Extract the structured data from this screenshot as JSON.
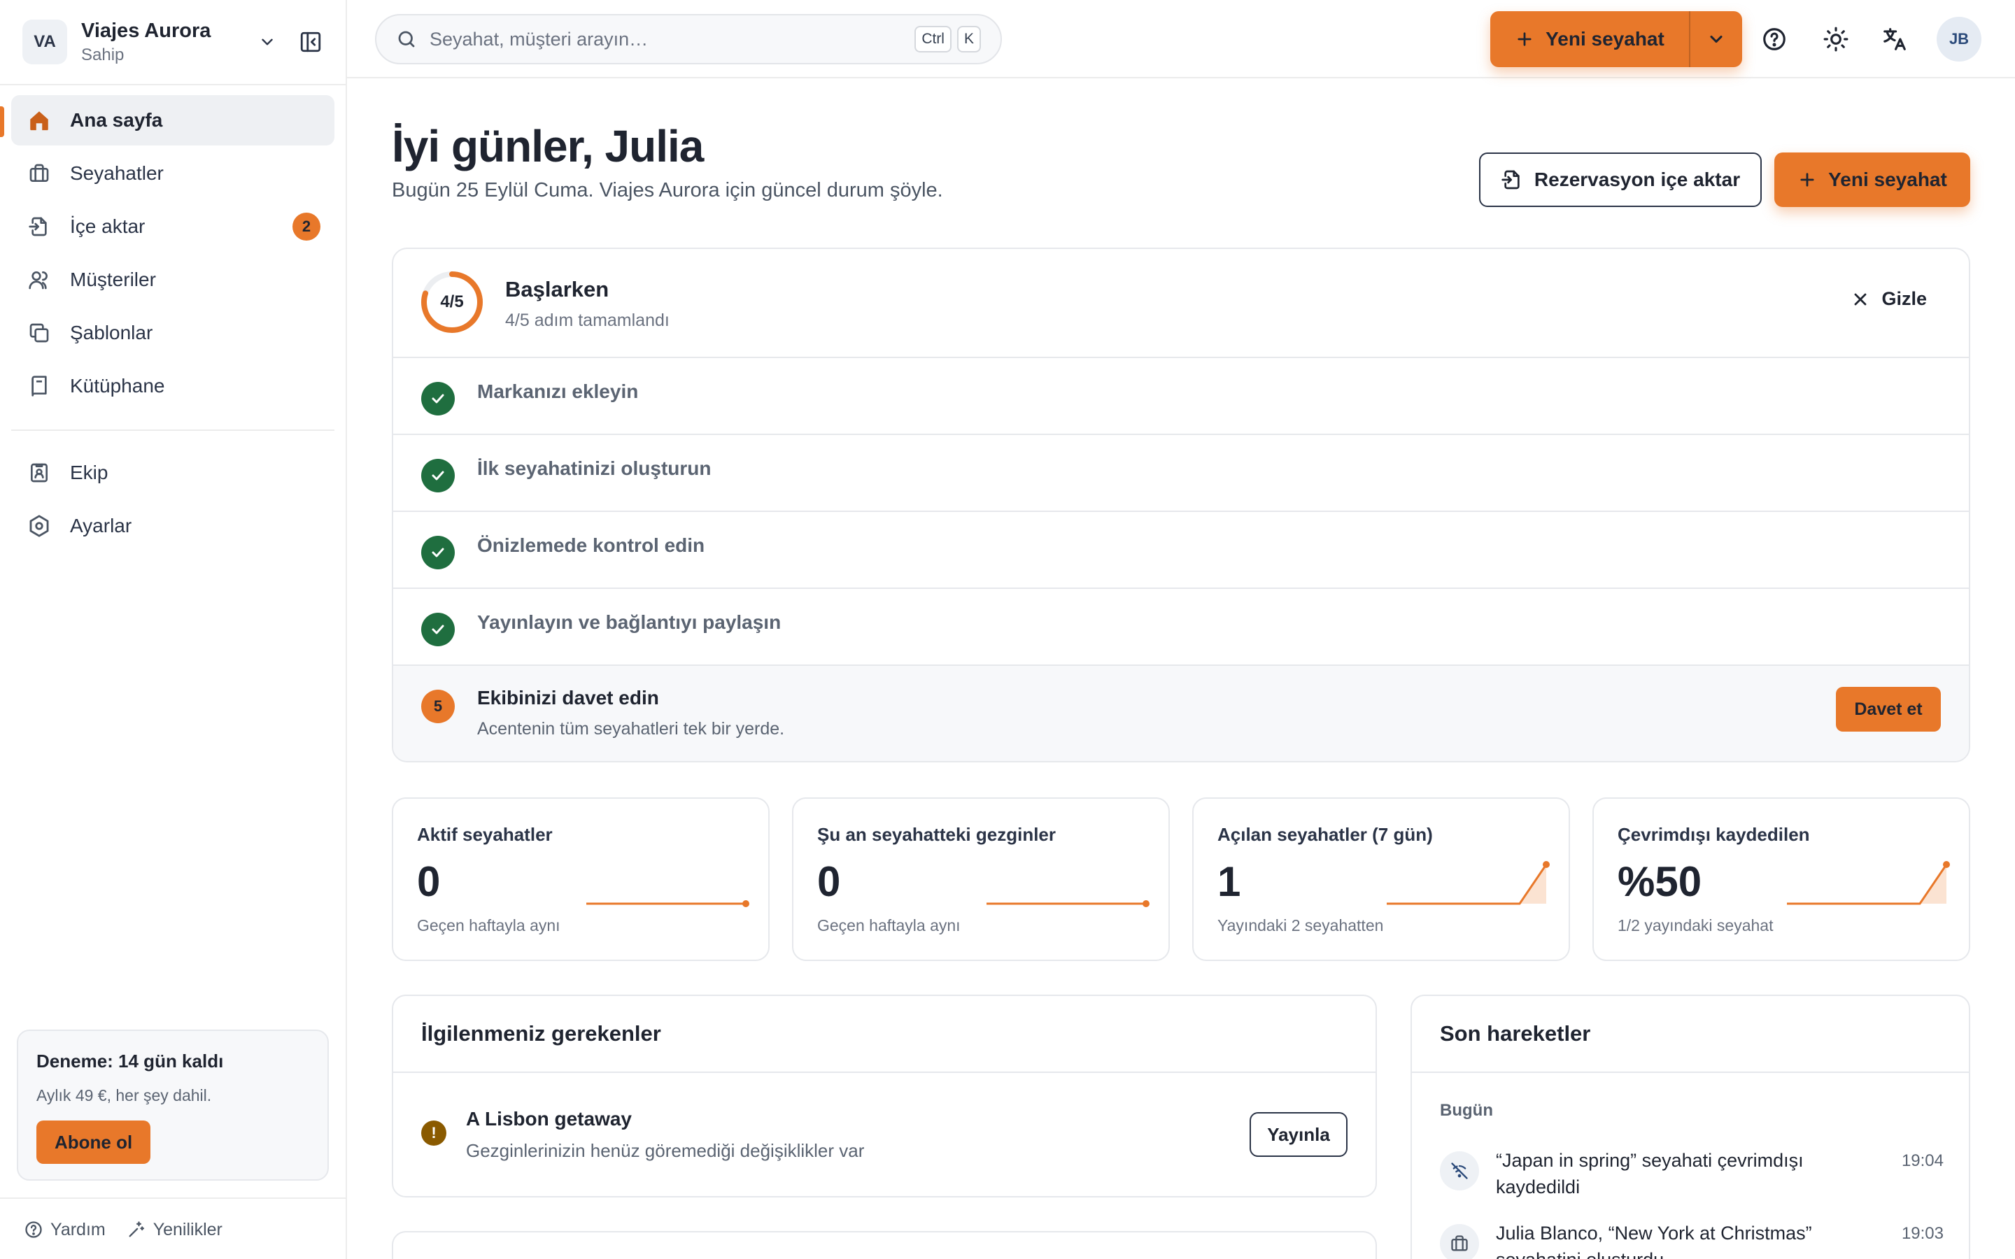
{
  "workspace": {
    "initials": "VA",
    "name": "Viajes Aurora",
    "role": "Sahip"
  },
  "nav": {
    "primary": [
      {
        "label": "Ana sayfa",
        "icon": "home-icon",
        "active": true
      },
      {
        "label": "Seyahatler",
        "icon": "briefcase-icon"
      },
      {
        "label": "İçe aktar",
        "icon": "file-import-icon",
        "badge": "2"
      },
      {
        "label": "Müşteriler",
        "icon": "users-icon"
      },
      {
        "label": "Şablonlar",
        "icon": "copy-icon"
      },
      {
        "label": "Kütüphane",
        "icon": "book-icon"
      }
    ],
    "secondary": [
      {
        "label": "Ekip",
        "icon": "id-card-icon"
      },
      {
        "label": "Ayarlar",
        "icon": "gear-icon"
      }
    ]
  },
  "trial": {
    "title": "Deneme: 14 gün kaldı",
    "subtitle": "Aylık 49 €, her şey dahil.",
    "button": "Abone ol"
  },
  "footer": {
    "help": "Yardım",
    "news": "Yenilikler"
  },
  "topbar": {
    "search_placeholder": "Seyahat, müşteri arayın…",
    "shortcut": [
      "Ctrl",
      "K"
    ],
    "new_trip": "Yeni seyahat",
    "user_initials": "JB"
  },
  "header": {
    "greeting": "İyi günler, Julia",
    "subtitle": "Bugün 25 Eylül Cuma. Viajes Aurora için güncel durum şöyle.",
    "import_button": "Rezervasyon içe aktar",
    "new_trip_button": "Yeni seyahat"
  },
  "onboarding": {
    "progress_label": "4/5",
    "progress": 0.8,
    "title": "Başlarken",
    "subtitle": "4/5 adım tamamlandı",
    "hide": "Gizle",
    "steps": [
      {
        "label": "Markanızı ekleyin",
        "done": true
      },
      {
        "label": "İlk seyahatinizi oluşturun",
        "done": true
      },
      {
        "label": "Önizlemede kontrol edin",
        "done": true
      },
      {
        "label": "Yayınlayın ve bağlantıyı paylaşın",
        "done": true
      }
    ],
    "next_step": {
      "number": "5",
      "label": "Ekibinizi davet edin",
      "description": "Acentenin tüm seyahatleri tek bir yerde.",
      "button": "Davet et"
    }
  },
  "stats": [
    {
      "title": "Aktif seyahatler",
      "value": "0",
      "footnote": "Geçen haftayla aynı",
      "trend": [
        0,
        0,
        0,
        0,
        0,
        0,
        0
      ]
    },
    {
      "title": "Şu an seyahatteki gezginler",
      "value": "0",
      "footnote": "Geçen haftayla aynı",
      "trend": [
        0,
        0,
        0,
        0,
        0,
        0,
        0
      ]
    },
    {
      "title": "Açılan seyahatler (7 gün)",
      "value": "1",
      "footnote": "Yayındaki 2 seyahatten",
      "trend": [
        0,
        0,
        0,
        0,
        0,
        0,
        1
      ]
    },
    {
      "title": "Çevrimdışı kaydedilen",
      "value": "%50",
      "footnote": "1/2 yayındaki seyahat",
      "trend": [
        0,
        0,
        0,
        0,
        0,
        0,
        1
      ]
    }
  ],
  "attention": {
    "title": "İlgilenmeniz gerekenler",
    "items": [
      {
        "title": "A Lisbon getaway",
        "description": "Gezginlerinizin henüz göremediği değişiklikler var",
        "button": "Yayınla"
      }
    ]
  },
  "activity": {
    "title": "Son hareketler",
    "group": "Bugün",
    "items": [
      {
        "text": "“Japan in spring” seyahati çevrimdışı kaydedildi",
        "time": "19:04",
        "icon": "wifi-off-icon"
      },
      {
        "text": "Julia Blanco, “New York at Christmas” seyahatini oluşturdu",
        "time": "19:03",
        "icon": "briefcase-icon"
      }
    ]
  },
  "colors": {
    "accent": "#e8782a",
    "success": "#1f6e3f",
    "warning": "#8a5a00",
    "border": "#e6e8ec"
  }
}
